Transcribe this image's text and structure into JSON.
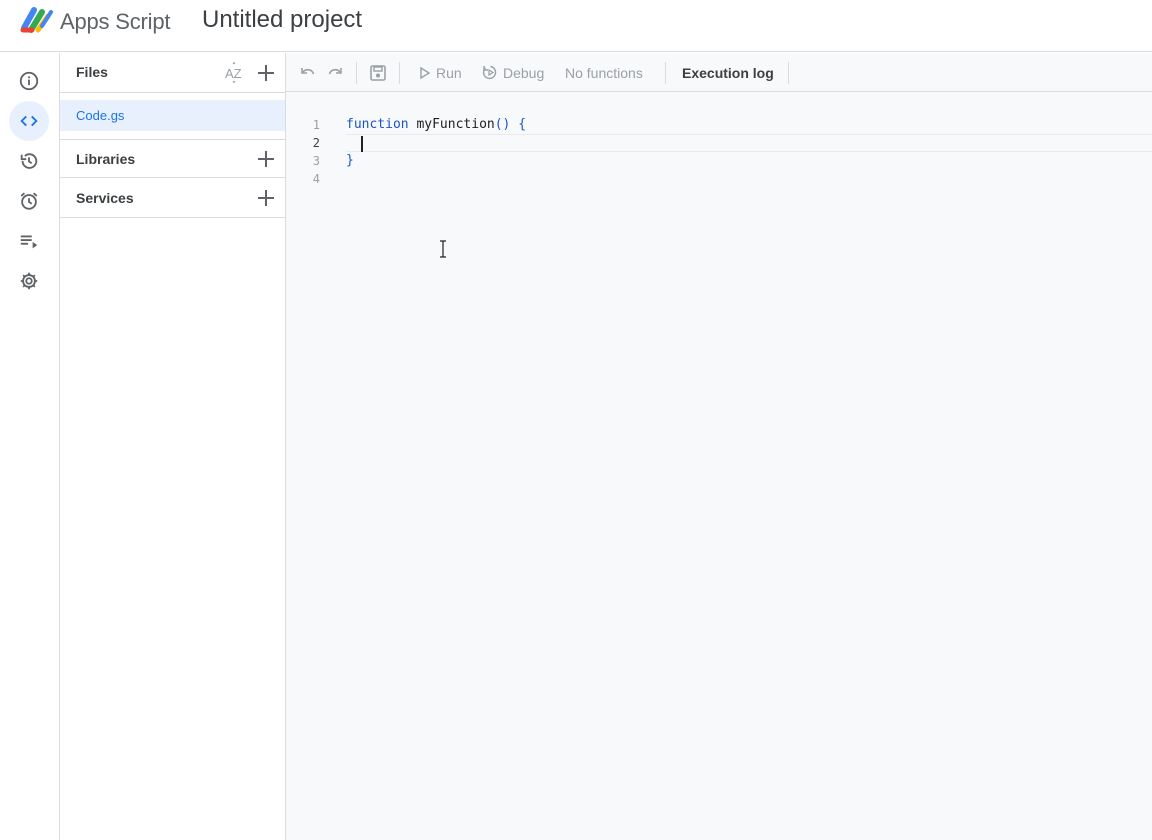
{
  "header": {
    "app_name": "Apps Script",
    "project_title": "Untitled project"
  },
  "rail": {
    "items": [
      {
        "name": "overview-icon",
        "active": false
      },
      {
        "name": "editor-icon",
        "active": true
      },
      {
        "name": "history-icon",
        "active": false
      },
      {
        "name": "triggers-icon",
        "active": false
      },
      {
        "name": "executions-icon",
        "active": false
      },
      {
        "name": "settings-icon",
        "active": false
      }
    ]
  },
  "files_panel": {
    "title": "Files",
    "files": [
      {
        "name": "Code.gs"
      }
    ],
    "libraries_label": "Libraries",
    "services_label": "Services"
  },
  "toolbar": {
    "run_label": "Run",
    "debug_label": "Debug",
    "function_select": "No functions",
    "execution_log_label": "Execution log"
  },
  "editor": {
    "line_numbers": [
      "1",
      "2",
      "3",
      "4"
    ],
    "keyword": "function",
    "function_name": "myFunction",
    "open_brace": "() {",
    "close_brace": "}",
    "current_line": 2
  },
  "colors": {
    "accent": "#1a73e8",
    "active_bg": "#e8f0fe",
    "border": "#dadce0",
    "editor_bg": "#f8f9fa"
  }
}
